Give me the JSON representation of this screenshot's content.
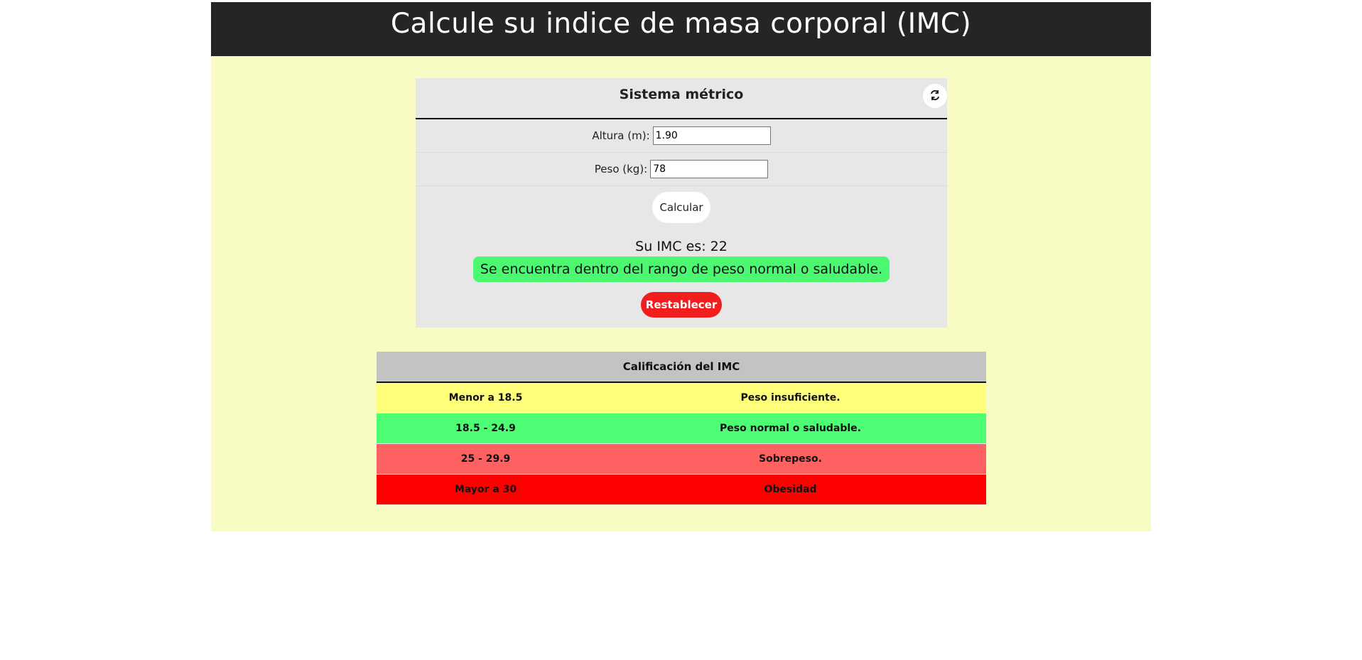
{
  "header": {
    "title": "Calcule su indice de masa corporal (IMC)"
  },
  "calculator": {
    "system_title": "Sistema métrico",
    "swap_icon": "swap-arrows-icon",
    "height_label": "Altura (m):",
    "height_value": "1.90",
    "weight_label": "Peso (kg):",
    "weight_value": "78",
    "calculate_label": "Calcular",
    "result_text": "Su IMC es: 22",
    "result_message": "Se encuentra dentro del rango de peso normal o saludable.",
    "reset_label": "Restablecer"
  },
  "table": {
    "header": "Calificación del IMC",
    "rows": [
      {
        "range": "Menor a 18.5",
        "label": "Peso insuficiente.",
        "color": "#fefe7a"
      },
      {
        "range": "18.5 - 24.9",
        "label": "Peso normal o saludable.",
        "color": "#4dfe74"
      },
      {
        "range": "25 - 29.9",
        "label": "Sobrepeso.",
        "color": "#fe6161"
      },
      {
        "range": "Mayor a 30",
        "label": "Obesidad",
        "color": "#fe0000"
      }
    ]
  },
  "colors": {
    "page_background": "#f8fbc3",
    "header_background": "#252525",
    "panel_background": "#e7e7e7",
    "result_highlight": "#4cf772",
    "reset_button": "#f21d1d"
  }
}
